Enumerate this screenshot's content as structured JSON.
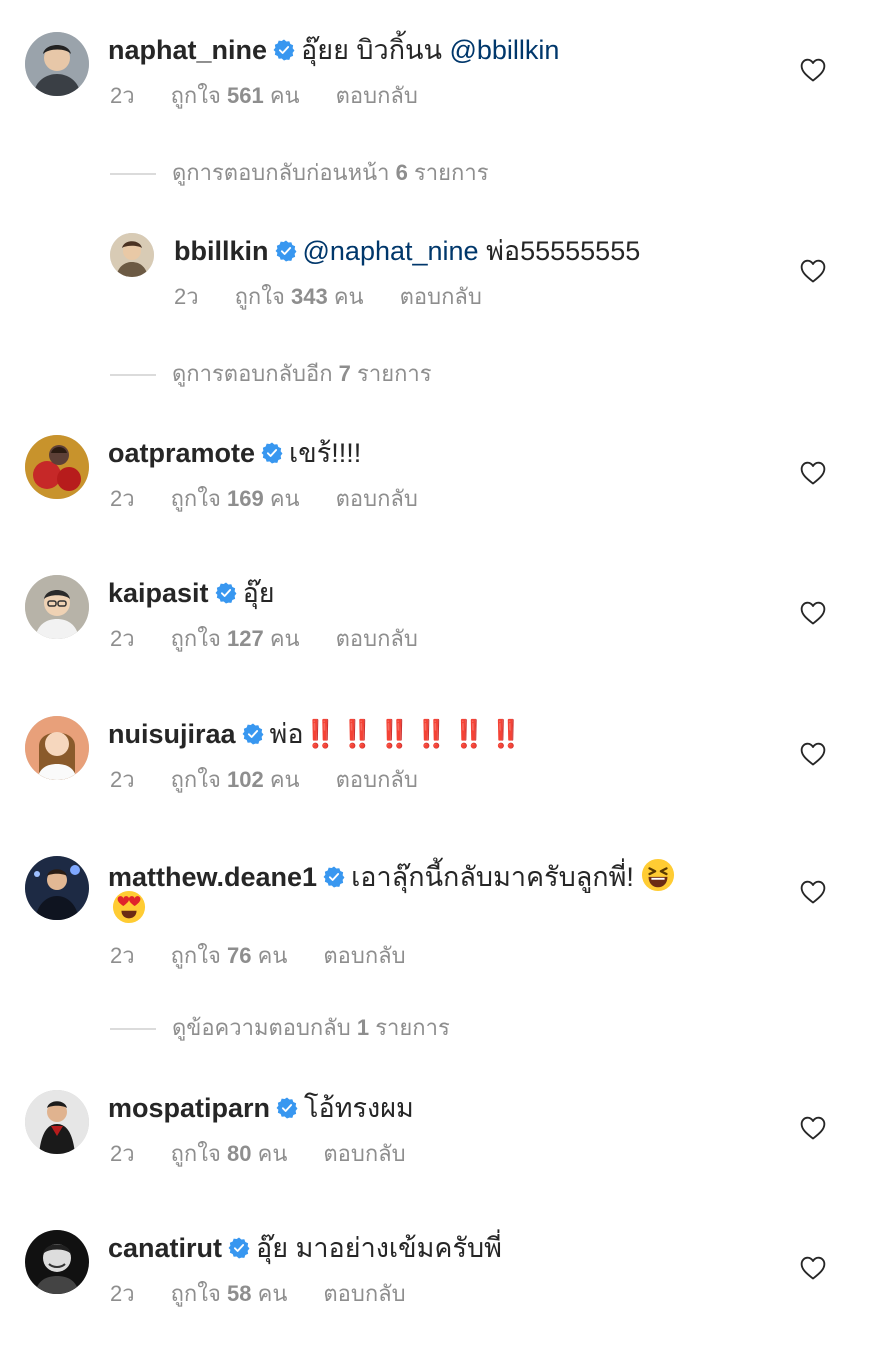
{
  "labels": {
    "time": "2ว",
    "likes_prefix": "ถูกใจ",
    "likes_suffix": "คน",
    "reply": "ตอบกลับ"
  },
  "colors": {
    "username": "#262626",
    "meta": "#8e8e8e",
    "mention": "#00376b",
    "verified": "#3897f0",
    "bang": "#e0242b"
  },
  "comments": [
    {
      "username": "naphat_nine",
      "verified": true,
      "text": "อุ๊ยย บิวกิ้นน",
      "mention": "@bbillkin",
      "time": "2ว",
      "likes": "561"
    },
    {
      "username": "bbillkin",
      "verified": true,
      "mention": "@naphat_nine",
      "text": "พ่อ55555555",
      "time": "2ว",
      "likes": "343"
    },
    {
      "username": "oatpramote",
      "verified": true,
      "text": "เขร้!!!!",
      "time": "2ว",
      "likes": "169"
    },
    {
      "username": "kaipasit",
      "verified": true,
      "text": "อุ๊ย",
      "time": "2ว",
      "likes": "127"
    },
    {
      "username": "nuisujiraa",
      "verified": true,
      "text": "พ่อ",
      "bangs": "‼️ ‼️ ‼️ ‼️ ‼️ ‼️",
      "bang_emoji": "double-exclamation-emoji",
      "time": "2ว",
      "likes": "102"
    },
    {
      "username": "matthew.deane1",
      "verified": true,
      "text": "เอาลุ๊กนี้กลับมาครับลูกพี่!",
      "emojis": [
        "laughing-face-emoji",
        "heart-eyes-emoji"
      ],
      "time": "2ว",
      "likes": "76"
    },
    {
      "username": "mospatiparn",
      "verified": true,
      "text": "โอ้ทรงผม",
      "time": "2ว",
      "likes": "80"
    },
    {
      "username": "canatirut",
      "verified": true,
      "text": "อุ๊ย มาอย่างเข้มครับพี่",
      "time": "2ว",
      "likes": "58"
    }
  ],
  "view_replies": [
    {
      "prefix": "ดูการตอบกลับก่อนหน้า",
      "count": "6",
      "suffix": "รายการ"
    },
    {
      "prefix": "ดูการตอบกลับอีก",
      "count": "7",
      "suffix": "รายการ"
    },
    {
      "prefix": "ดูข้อความตอบกลับ",
      "count": "1",
      "suffix": "รายการ"
    }
  ],
  "icons": {
    "verified": "verified-badge-icon",
    "like": "heart-outline-icon",
    "avatar": "avatar"
  }
}
